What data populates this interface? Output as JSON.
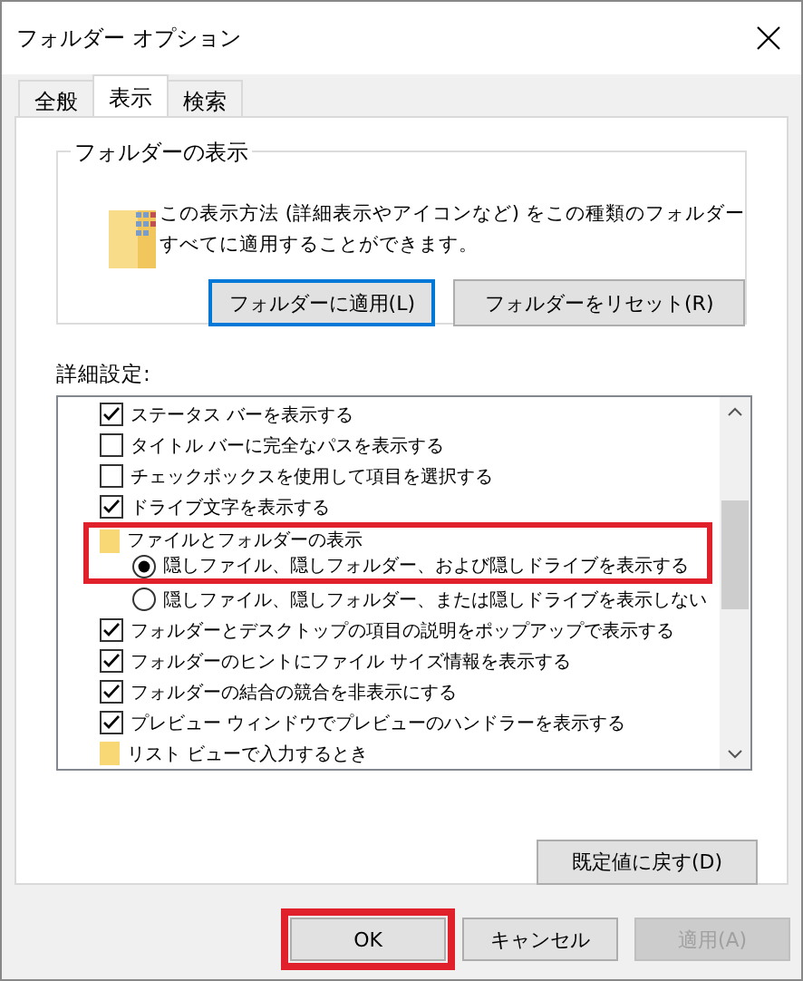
{
  "window": {
    "title": "フォルダー オプション"
  },
  "tabs": [
    {
      "label": "全般",
      "selected": false
    },
    {
      "label": "表示",
      "selected": true
    },
    {
      "label": "検索",
      "selected": false
    }
  ],
  "folder_views": {
    "title": "フォルダーの表示",
    "description": "この表示方法 (詳細表示やアイコンなど) をこの種類のフォルダーすべてに適用することができます。",
    "buttons": [
      {
        "label": "フォルダーに適用(L)",
        "focused": true
      },
      {
        "label": "フォルダーをリセット(R)",
        "focused": false
      }
    ]
  },
  "advanced": {
    "label": "詳細設定:",
    "items": [
      {
        "kind": "checkbox",
        "label": "ステータス バーを表示する",
        "checked": true,
        "highlighted": false
      },
      {
        "kind": "checkbox",
        "label": "タイトル バーに完全なパスを表示する",
        "checked": false,
        "highlighted": false
      },
      {
        "kind": "checkbox",
        "label": "チェックボックスを使用して項目を選択する",
        "checked": false,
        "highlighted": false
      },
      {
        "kind": "checkbox",
        "label": "ドライブ文字を表示する",
        "checked": true,
        "highlighted": false
      },
      {
        "kind": "folder",
        "label": "ファイルとフォルダーの表示",
        "highlighted": true,
        "children": [
          {
            "kind": "radio",
            "label": "隠しファイル、隠しフォルダー、および隠しドライブを表示する",
            "selected": true,
            "highlighted": true
          },
          {
            "kind": "radio",
            "label": "隠しファイル、隠しフォルダー、または隠しドライブを表示しない",
            "selected": false,
            "highlighted": false
          }
        ]
      },
      {
        "kind": "checkbox",
        "label": "フォルダーとデスクトップの項目の説明をポップアップで表示する",
        "checked": true,
        "highlighted": false
      },
      {
        "kind": "checkbox",
        "label": "フォルダーのヒントにファイル サイズ情報を表示する",
        "checked": true,
        "highlighted": false
      },
      {
        "kind": "checkbox",
        "label": "フォルダーの結合の競合を非表示にする",
        "checked": true,
        "highlighted": false
      },
      {
        "kind": "checkbox",
        "label": "プレビュー ウィンドウでプレビューのハンドラーを表示する",
        "checked": true,
        "highlighted": false
      },
      {
        "kind": "folder",
        "label": "リスト ビューで入力するとき",
        "highlighted": false
      }
    ],
    "restore_button": "既定値に戻す(D)"
  },
  "buttons": [
    {
      "label": "OK",
      "disabled": false,
      "highlighted": true
    },
    {
      "label": "キャンセル",
      "disabled": false,
      "highlighted": false
    },
    {
      "label": "適用(A)",
      "disabled": true,
      "highlighted": false
    }
  ]
}
